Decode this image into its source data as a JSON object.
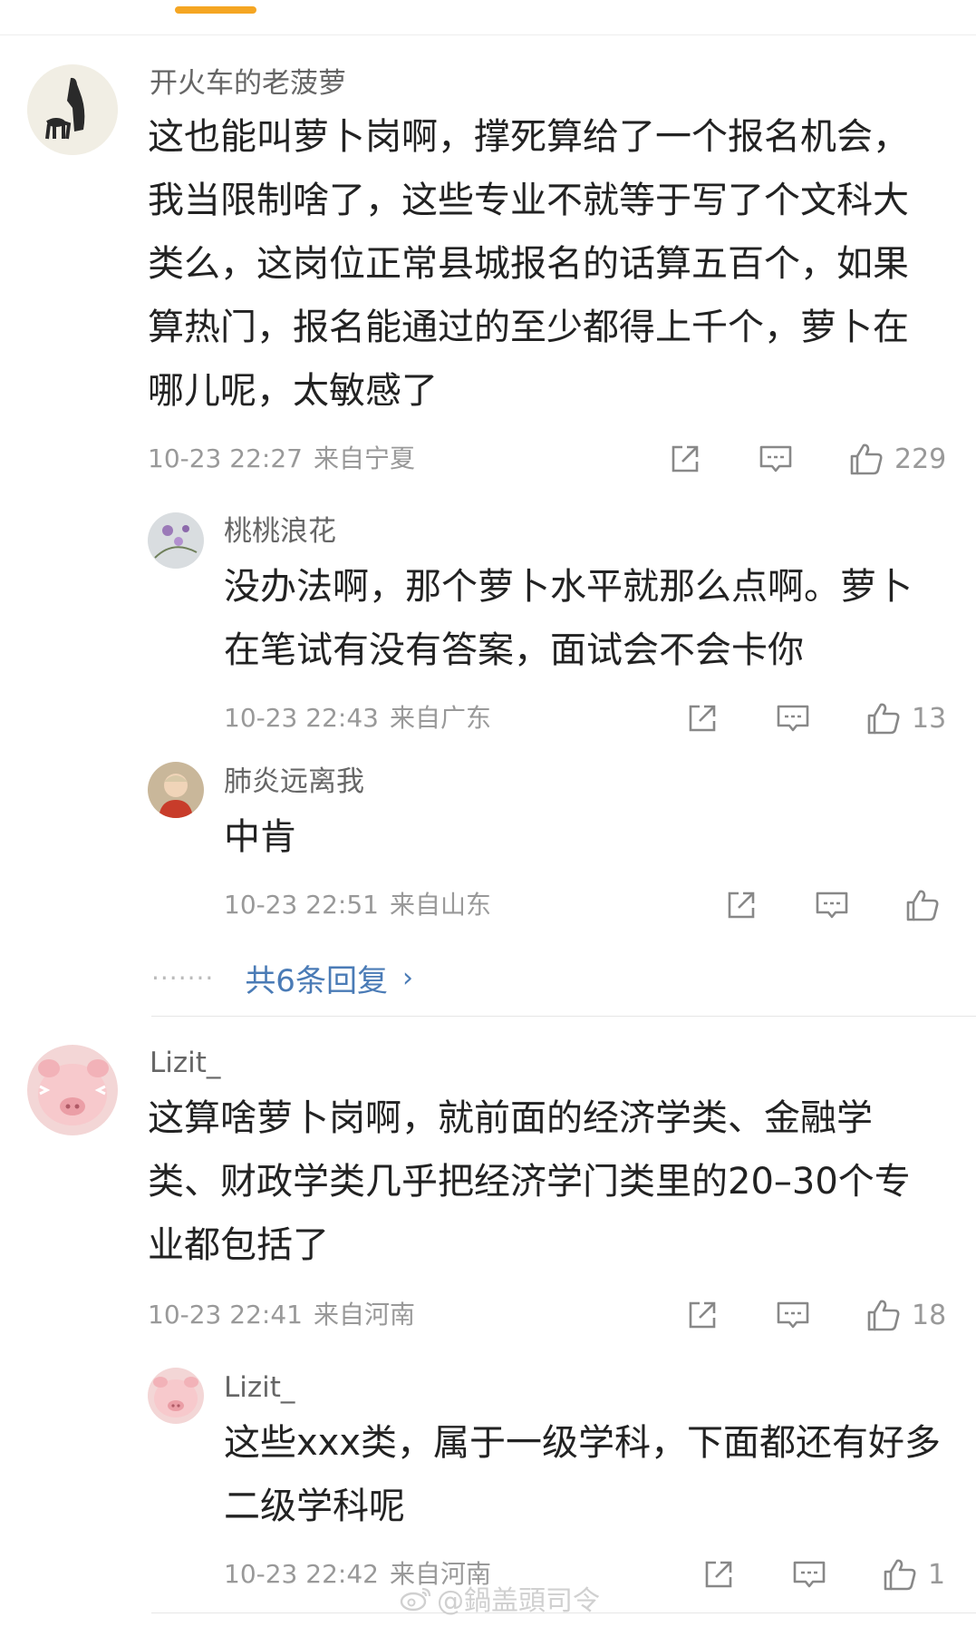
{
  "comments": [
    {
      "username": "开火车的老菠萝",
      "content": "这也能叫萝卜岗啊，撑死算给了一个报名机会，我当限制啥了，这些专业不就等于写了个文科大类么，这岗位正常县城报名的话算五百个，如果算热门，报名能通过的至少都得上千个，萝卜在哪儿呢，太敏感了",
      "time": "10-23 22:27",
      "location": "来自宁夏",
      "likes": "229",
      "replies": [
        {
          "username": "桃桃浪花",
          "content": "没办法啊，那个萝卜水平就那么点啊。萝卜在笔试有没有答案，面试会不会卡你",
          "time": "10-23 22:43",
          "location": "来自广东",
          "likes": "13"
        },
        {
          "username": "肺炎远离我",
          "content": "中肯",
          "time": "10-23 22:51",
          "location": "来自山东",
          "likes": ""
        }
      ],
      "more_replies_label": "共6条回复"
    },
    {
      "username": "Lizit_",
      "content": "这算啥萝卜岗啊，就前面的经济学类、金融学类、财政学类几乎把经济学门类里的20–30个专业都包括了",
      "time": "10-23 22:41",
      "location": "来自河南",
      "likes": "18",
      "replies": [
        {
          "username": "Lizit_",
          "content": "这些xxx类，属于一级学科，下面都还有好多二级学科呢",
          "time": "10-23 22:42",
          "location": "来自河南",
          "likes": "1"
        }
      ]
    }
  ],
  "more_dots": "·······",
  "more_chevron": "›",
  "watermark": "@鍋盖頭司令",
  "colors": {
    "accent": "#f5a623",
    "link": "#4a7bb6",
    "meta": "#999999",
    "text": "#222222"
  },
  "icons": {
    "share": "share-icon",
    "comment": "comment-icon",
    "like": "thumbs-up-icon",
    "watermark": "weibo-logo-icon"
  }
}
